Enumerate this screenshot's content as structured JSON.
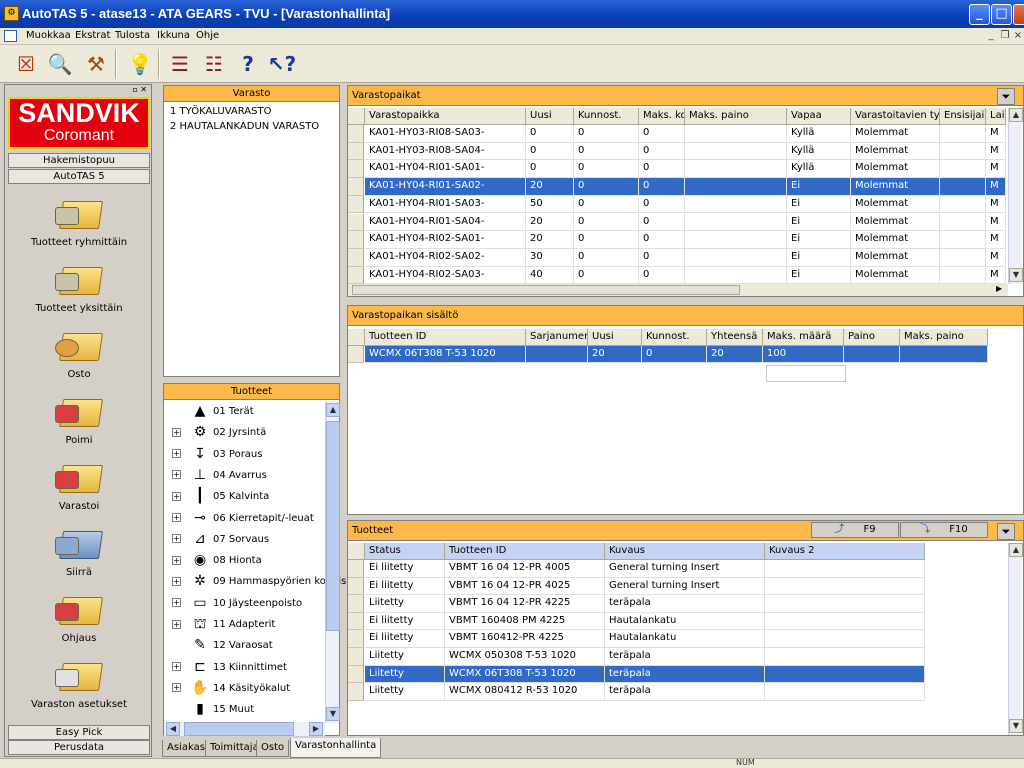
{
  "window": {
    "title": "AutoTAS 5 - atase13 - ATA GEARS - TVU - [Varastonhallinta]",
    "app_icon": "gear-box-icon"
  },
  "menu": [
    "Muokkaa",
    "Ekstrat",
    "Tulosta",
    "Ikkuna",
    "Ohje"
  ],
  "left": {
    "logo_line1": "SANDVIK",
    "logo_line2": "Coromant",
    "top_buttons": [
      "Hakemistopuu",
      "AutoTAS 5"
    ],
    "items": [
      "Tuotteet ryhmittäin",
      "Tuotteet yksittäin",
      "Osto",
      "Poimi",
      "Varastoi",
      "Siirrä",
      "Ohjaus",
      "Varaston asetukset"
    ],
    "bottom_buttons": [
      "Easy Pick",
      "Perusdata"
    ]
  },
  "varasto": {
    "header": "Varasto",
    "items": [
      "1 TYÖKALUVARASTO",
      "2 HAUTALANKADUN VARASTO"
    ]
  },
  "tuotteet_tree": {
    "header": "Tuotteet",
    "items": [
      {
        "label": "01 Terät",
        "icon": "insert-icon",
        "expandable": false
      },
      {
        "label": "02 Jyrsintä",
        "icon": "milling-icon",
        "expandable": true
      },
      {
        "label": "03 Poraus",
        "icon": "drill-icon",
        "expandable": true
      },
      {
        "label": "04 Avarrus",
        "icon": "boring-icon",
        "expandable": true
      },
      {
        "label": "05 Kalvinta",
        "icon": "reamer-icon",
        "expandable": true
      },
      {
        "label": "06 Kierretapit/-leuat",
        "icon": "tap-icon",
        "expandable": true
      },
      {
        "label": "07 Sorvaus",
        "icon": "turning-icon",
        "expandable": true
      },
      {
        "label": "08 Hionta",
        "icon": "grinding-icon",
        "expandable": true
      },
      {
        "label": "09 Hammaspyörien koneis",
        "icon": "gear-icon",
        "expandable": true
      },
      {
        "label": "10 Jäysteenpoisto",
        "icon": "deburr-icon",
        "expandable": true
      },
      {
        "label": "11 Adapterit",
        "icon": "adapter-icon",
        "expandable": true
      },
      {
        "label": "12 Varaosat",
        "icon": "spare-parts-icon",
        "expandable": false
      },
      {
        "label": "13 Kiinnittimet",
        "icon": "clamp-icon",
        "expandable": true
      },
      {
        "label": "14 Käsityökalut",
        "icon": "hand-tool-icon",
        "expandable": true
      },
      {
        "label": "15 Muut",
        "icon": "other-icon",
        "expandable": false
      }
    ]
  },
  "varastopaikat": {
    "header": "Varastopaikat",
    "columns": [
      "Varastopaikka",
      "Uusi",
      "Kunnost.",
      "Maks. kor",
      "Maks. paino",
      "Vapaa",
      "Varastoitavien tyypp",
      "Ensisijaine",
      "Lai"
    ],
    "rows": [
      [
        "KA01-HY03-RI08-SA03-",
        "0",
        "0",
        "0",
        "",
        "Kyllä",
        "Molemmat",
        "",
        "M"
      ],
      [
        "KA01-HY03-RI08-SA04-",
        "0",
        "0",
        "0",
        "",
        "Kyllä",
        "Molemmat",
        "",
        "M"
      ],
      [
        "KA01-HY04-RI01-SA01-",
        "0",
        "0",
        "0",
        "",
        "Kyllä",
        "Molemmat",
        "",
        "M"
      ],
      [
        "KA01-HY04-RI01-SA02-",
        "20",
        "0",
        "0",
        "",
        "Ei",
        "Molemmat",
        "",
        "M"
      ],
      [
        "KA01-HY04-RI01-SA03-",
        "50",
        "0",
        "0",
        "",
        "Ei",
        "Molemmat",
        "",
        "M"
      ],
      [
        "KA01-HY04-RI01-SA04-",
        "20",
        "0",
        "0",
        "",
        "Ei",
        "Molemmat",
        "",
        "M"
      ],
      [
        "KA01-HY04-RI02-SA01-",
        "20",
        "0",
        "0",
        "",
        "Ei",
        "Molemmat",
        "",
        "M"
      ],
      [
        "KA01-HY04-RI02-SA02-",
        "30",
        "0",
        "0",
        "",
        "Ei",
        "Molemmat",
        "",
        "M"
      ],
      [
        "KA01-HY04-RI02-SA03-",
        "40",
        "0",
        "0",
        "",
        "Ei",
        "Molemmat",
        "",
        "M"
      ]
    ],
    "selected_row": 3
  },
  "sisalto": {
    "header": "Varastopaikan sisältö",
    "columns": [
      "Tuotteen ID",
      "Sarjanumero",
      "Uusi",
      "Kunnost.",
      "Yhteensä",
      "Maks. määrä",
      "Paino",
      "Maks. paino"
    ],
    "rows": [
      [
        "WCMX 06T308 T-53 1020",
        "",
        "20",
        "0",
        "20",
        "100",
        "",
        ""
      ]
    ]
  },
  "tuotteet_grid": {
    "header": "Tuotteet",
    "f9_label": "F9",
    "f10_label": "F10",
    "columns": [
      "Status",
      "Tuotteen ID",
      "Kuvaus",
      "Kuvaus 2"
    ],
    "rows": [
      [
        "Ei liitetty",
        "VBMT 16 04 12-PR 4005",
        "General turning Insert",
        ""
      ],
      [
        "Ei liitetty",
        "VBMT 16 04 12-PR 4025",
        "General turning Insert",
        ""
      ],
      [
        "Liitetty",
        "VBMT 16 04 12-PR 4225",
        "teräpala",
        ""
      ],
      [
        "Ei liitetty",
        "VBMT 160408 PM 4225",
        "Hautalankatu",
        ""
      ],
      [
        "Ei liitetty",
        "VBMT 160412-PR 4225",
        "Hautalankatu",
        ""
      ],
      [
        "Liitetty",
        "WCMX 050308 T-53 1020",
        "teräpala",
        ""
      ],
      [
        "Liitetty",
        "WCMX 06T308 T-53 1020",
        "teräpala",
        ""
      ],
      [
        "Liitetty",
        "WCMX 080412 R-53 1020",
        "teräpala",
        ""
      ]
    ],
    "selected_row": 6
  },
  "tabs": [
    "Asiakas",
    "Toimittaja",
    "Osto",
    "Varastonhallinta"
  ],
  "active_tab": 3,
  "status": {
    "num": "NUM"
  },
  "colors": {
    "header": "#fdb84a",
    "selection": "#316ac5",
    "titlebar": "#0a3fb4",
    "logo": "#e3010f"
  }
}
